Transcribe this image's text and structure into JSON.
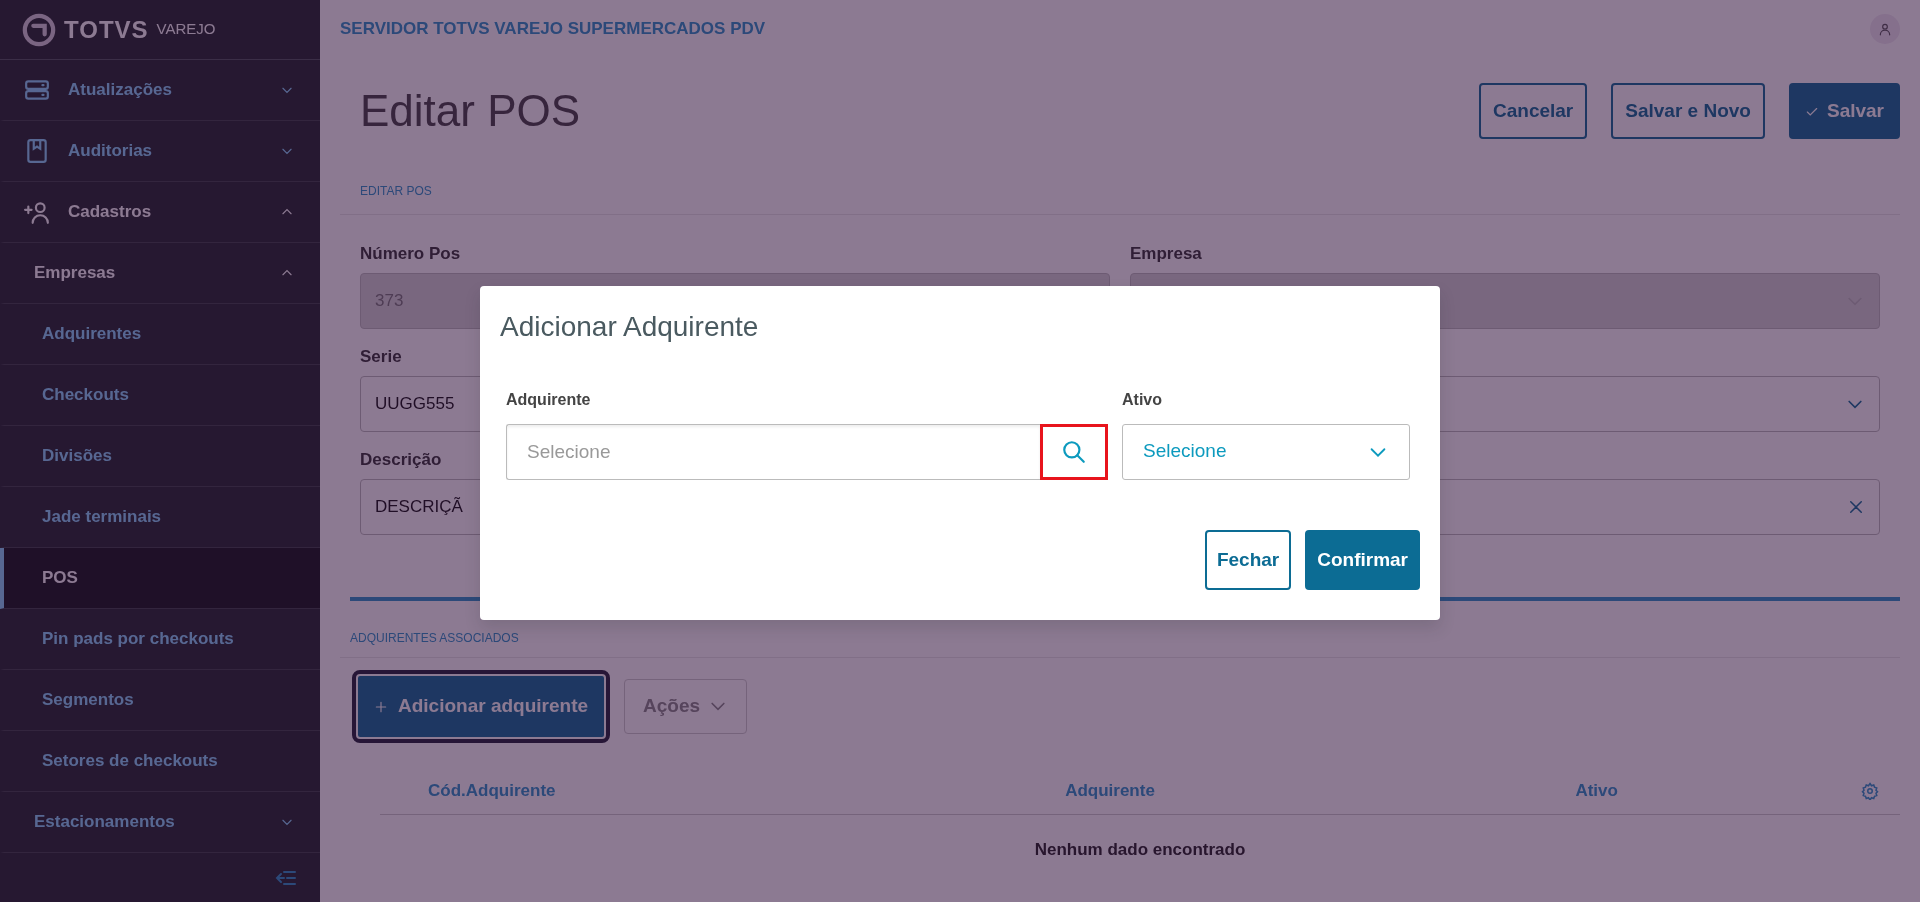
{
  "sidebar": {
    "logo": {
      "brand": "TOTVS",
      "product": "VAREJO"
    },
    "items": [
      {
        "label": "Atualizações",
        "expanded": false,
        "selected": false
      },
      {
        "label": "Auditorias",
        "expanded": false,
        "selected": false
      },
      {
        "label": "Cadastros",
        "expanded": true,
        "selected": false,
        "children": [
          {
            "label": "Empresas",
            "expanded": true,
            "selected": false,
            "children": [
              {
                "label": "Adquirentes",
                "selected": false
              },
              {
                "label": "Checkouts",
                "selected": false
              },
              {
                "label": "Divisões",
                "selected": false
              },
              {
                "label": "Jade terminais",
                "selected": false
              },
              {
                "label": "POS",
                "selected": true
              },
              {
                "label": "Pin pads por checkouts",
                "selected": false
              },
              {
                "label": "Segmentos",
                "selected": false
              },
              {
                "label": "Setores de checkouts",
                "selected": false
              }
            ]
          },
          {
            "label": "Estacionamentos",
            "expanded": false,
            "selected": false
          }
        ]
      }
    ]
  },
  "header": {
    "title": "SERVIDOR TOTVS VAREJO SUPERMERCADOS PDV"
  },
  "page": {
    "title": "Editar POS",
    "actions": [
      {
        "label": "Cancelar",
        "kind": "outline"
      },
      {
        "label": "Salvar e Novo",
        "kind": "outline"
      },
      {
        "label": "Salvar",
        "kind": "primary"
      }
    ]
  },
  "form": {
    "section": "EDITAR POS",
    "fields": [
      {
        "label": "Número Pos",
        "value": "373",
        "kind": "input",
        "disabled": true
      },
      {
        "label": "Empresa",
        "kind": "select",
        "disabled": true
      },
      {
        "label": "Serie",
        "value": "UUGG555",
        "kind": "input",
        "disabled": false
      },
      {
        "kind": "select",
        "disabled": false
      },
      {
        "label": "Descrição",
        "value": "DESCRIÇÃ",
        "kind": "input",
        "disabled": false
      },
      {
        "kind": "clearable",
        "disabled": false
      }
    ]
  },
  "associated": {
    "section": "ADQUIRENTES ASSOCIADOS",
    "add_button": "Adicionar adquirente",
    "actions_button": {
      "label": "Ações",
      "disabled": true
    },
    "table": {
      "columns": [
        "Cód.Adquirente",
        "Adquirente",
        "Ativo"
      ],
      "empty": "Nenhum dado encontrado"
    }
  },
  "modal": {
    "title": "Adicionar Adquirente",
    "adquirente": {
      "label": "Adquirente",
      "placeholder": "Selecione",
      "search_highlighted": true
    },
    "ativo": {
      "label": "Ativo",
      "value": "Selecione"
    },
    "buttons": [
      {
        "label": "Fechar",
        "kind": "outline"
      },
      {
        "label": "Confirmar",
        "kind": "primary"
      }
    ]
  }
}
